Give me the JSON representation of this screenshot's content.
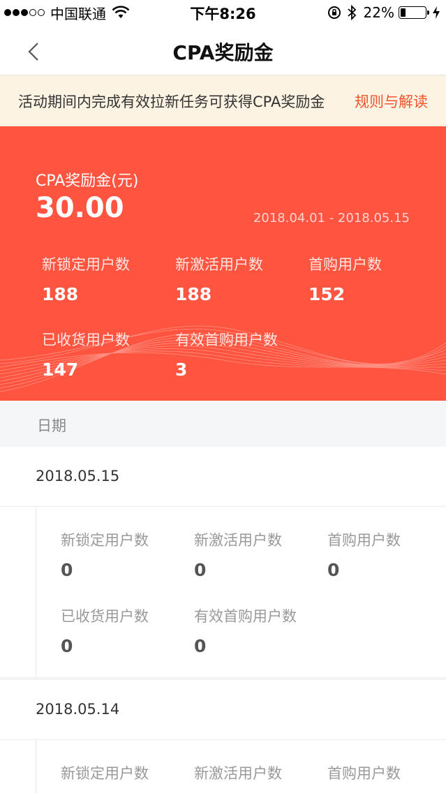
{
  "status_bar": {
    "carrier": "中国联通",
    "time": "下午8:26",
    "battery_percent": "22%",
    "battery_level": 0.22
  },
  "nav": {
    "title": "CPA奖励金"
  },
  "notice": {
    "text": "活动期间内完成有效拉新任务可获得CPA奖励金",
    "link": "规则与解读"
  },
  "summary": {
    "label": "CPA奖励金(元)",
    "amount": "30.00",
    "date_range": "2018.04.01 - 2018.05.15",
    "stats": [
      {
        "label": "新锁定用户数",
        "value": "188"
      },
      {
        "label": "新激活用户数",
        "value": "188"
      },
      {
        "label": "首购用户数",
        "value": "152"
      },
      {
        "label": "已收货用户数",
        "value": "147"
      },
      {
        "label": "有效首购用户数",
        "value": "3"
      }
    ]
  },
  "date_header": "日期",
  "days": [
    {
      "date": "2018.05.15",
      "stats": [
        {
          "label": "新锁定用户数",
          "value": "0"
        },
        {
          "label": "新激活用户数",
          "value": "0"
        },
        {
          "label": "首购用户数",
          "value": "0"
        },
        {
          "label": "已收货用户数",
          "value": "0"
        },
        {
          "label": "有效首购用户数",
          "value": "0"
        }
      ]
    },
    {
      "date": "2018.05.14",
      "stats": [
        {
          "label": "新锁定用户数",
          "value": ""
        },
        {
          "label": "新激活用户数",
          "value": ""
        },
        {
          "label": "首购用户数",
          "value": ""
        }
      ]
    }
  ]
}
